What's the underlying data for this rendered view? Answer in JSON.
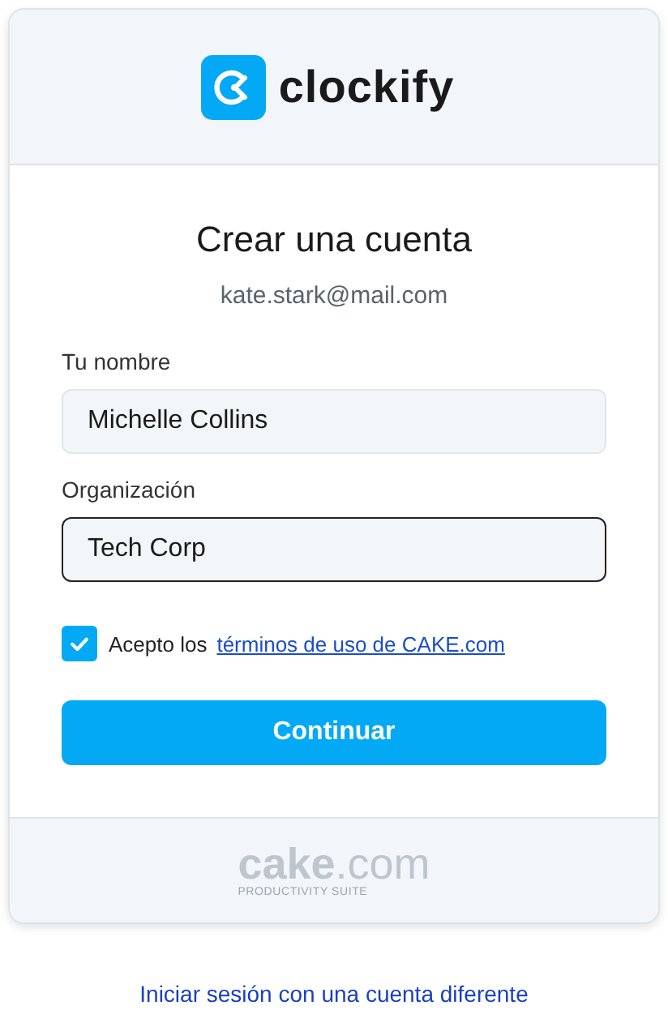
{
  "brand": {
    "name": "clockify"
  },
  "title": "Crear una cuenta",
  "email": "kate.stark@mail.com",
  "fields": [
    {
      "label": "Tu nombre",
      "value": "Michelle Collins",
      "focused": false
    },
    {
      "label": "Organización",
      "value": "Tech Corp",
      "focused": true
    }
  ],
  "terms": {
    "checked": true,
    "text": "Acepto los",
    "link": "términos de uso de CAKE.com"
  },
  "submit": "Continuar",
  "footer": {
    "logo": "**cake**.com",
    "tagline": "PRODUCTIVITY SUITE"
  },
  "alt_link": "Iniciar sesión con una cuenta diferente"
}
